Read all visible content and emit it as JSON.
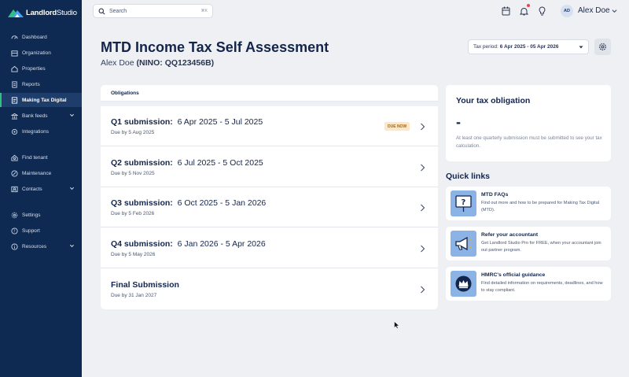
{
  "brand": {
    "name_bold": "Landlord",
    "name_light": "Studio"
  },
  "sidebar": {
    "items": [
      {
        "label": "Dashboard",
        "icon": "dashboard-icon"
      },
      {
        "label": "Organization",
        "icon": "organization-icon"
      },
      {
        "label": "Properties",
        "icon": "home-icon"
      },
      {
        "label": "Reports",
        "icon": "reports-icon"
      },
      {
        "label": "Making Tax Digital",
        "icon": "mtd-icon",
        "active": true
      },
      {
        "label": "Bank feeds",
        "icon": "bank-icon",
        "expandable": true
      },
      {
        "label": "Integrations",
        "icon": "integrations-icon"
      },
      {
        "label": "Find tenant",
        "icon": "find-tenant-icon"
      },
      {
        "label": "Maintenance",
        "icon": "maintenance-icon"
      },
      {
        "label": "Contacts",
        "icon": "contacts-icon",
        "expandable": true
      },
      {
        "label": "Settings",
        "icon": "settings-icon"
      },
      {
        "label": "Support",
        "icon": "support-icon"
      },
      {
        "label": "Resources",
        "icon": "info-icon",
        "expandable": true
      }
    ]
  },
  "topbar": {
    "search": {
      "placeholder": "Search",
      "shortcut": "⌘K"
    },
    "user": {
      "initials": "AD",
      "name": "Alex Doe"
    }
  },
  "header": {
    "title": "MTD Income Tax Self Assessment",
    "user_name": "Alex Doe",
    "nino": "(NINO: QQ123456B)",
    "tax_period_label": "Tax period:",
    "tax_period_value": "6 Apr 2025 - 05 Apr 2026"
  },
  "obligations": {
    "heading": "Obligations",
    "rows": [
      {
        "title_bold": "Q1 submission:",
        "title_range": "6 Apr 2025 - 5 Jul 2025",
        "due": "Due by 5 Aug 2025",
        "badge": "DUE NOW"
      },
      {
        "title_bold": "Q2 submission:",
        "title_range": "6 Jul 2025 - 5 Oct 2025",
        "due": "Due by 5 Nov 2025"
      },
      {
        "title_bold": "Q3 submission:",
        "title_range": "6 Oct 2025 - 5 Jan 2026",
        "due": "Due by 5 Feb 2026"
      },
      {
        "title_bold": "Q4 submission:",
        "title_range": "6 Jan 2026 - 5 Apr 2026",
        "due": "Due by 5 May 2026"
      },
      {
        "title_bold": "Final Submission",
        "title_range": "",
        "due": "Due by 31 Jan 2027"
      }
    ]
  },
  "tax_obligation": {
    "title": "Your tax obligation",
    "amount": "-",
    "note": "At least one quarterly submission must be submitted to see your tax calculation."
  },
  "quick_links": {
    "title": "Quick links",
    "items": [
      {
        "name": "MTD FAQs",
        "desc": "Find out more and how to be prepared for Making Tax Digital (MTD).",
        "icon": "faq-sign-icon"
      },
      {
        "name": "Refer your accountant",
        "desc": "Get Landlord Studio Pro for FREE, when your accountant join out partner program.",
        "icon": "megaphone-icon"
      },
      {
        "name": "HMRC's official guidance",
        "desc": "Find detailed information on requirements, deadlines, and how to stay compliant.",
        "icon": "crown-icon"
      }
    ]
  },
  "colors": {
    "sidebar": "#0f2a52",
    "accent": "#2ec27e",
    "badge_bg": "#fde7c7",
    "badge_text": "#a86508",
    "quicklink_icon_bg": "#8bb3e6"
  }
}
